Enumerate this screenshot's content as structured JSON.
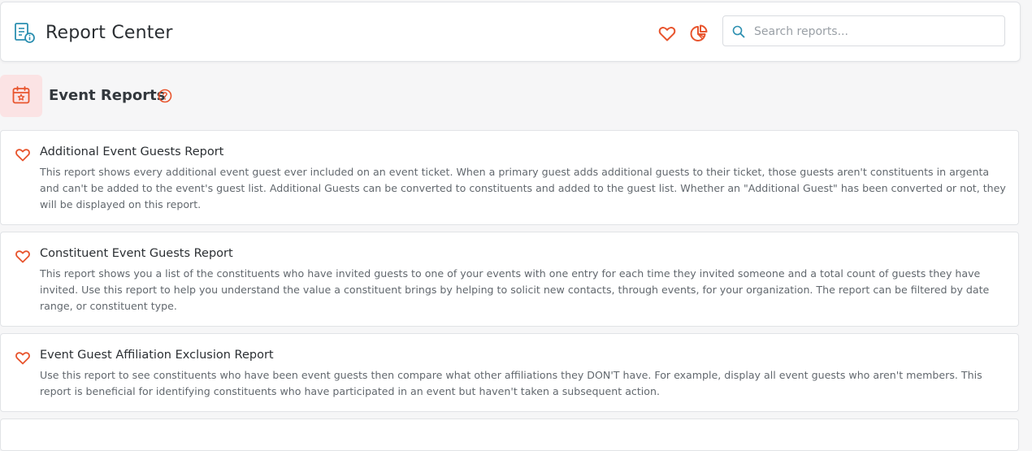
{
  "header": {
    "title": "Report Center",
    "icons": {
      "app": "report-center-icon",
      "favorites": "heart-icon",
      "charts": "pie-chart-icon",
      "search": "search-icon"
    },
    "search_placeholder": "Search reports..."
  },
  "section": {
    "title": "Event Reports",
    "icon": "calendar-star-icon",
    "help_icon": "question-circle-icon"
  },
  "reports": [
    {
      "title": "Additional Event Guests Report",
      "description": "This report shows every additional event guest ever included on an event ticket. When a primary guest adds additional guests to their ticket, those guests aren't constituents in argenta and can't be added to the event's guest list. Additional Guests can be converted to constituents and added to the guest list. Whether an \"Additional Guest\" has been converted or not, they will be displayed on this report."
    },
    {
      "title": "Constituent Event Guests Report",
      "description": "This report shows you a list of the constituents who have invited guests to one of your events with one entry for each time they invited someone and a total count of guests they have invited. Use this report to help you understand the value a constituent brings by helping to solicit new contacts, through events, for your organization. The report can be filtered by date range, or constituent type."
    },
    {
      "title": "Event Guest Affiliation Exclusion Report",
      "description": "Use this report to see constituents who have been event guests then compare what other affiliations they DON'T have. For example, display all event guests who aren't members. This report is beneficial for identifying constituents who have participated in an event but haven't taken a subsequent action."
    }
  ],
  "colors": {
    "accent": "#e8552e",
    "teal": "#2b8fb0",
    "section_bg": "#fbe3e4",
    "page_bg": "#f6f6f7"
  }
}
